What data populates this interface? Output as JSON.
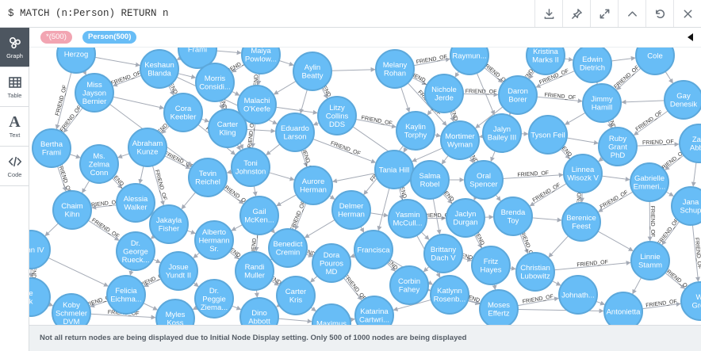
{
  "query": "$ MATCH (n:Person) RETURN n",
  "toolbar": [
    {
      "name": "download-icon"
    },
    {
      "name": "pin-icon"
    },
    {
      "name": "expand-icon"
    },
    {
      "name": "collapse-up-icon"
    },
    {
      "name": "rerun-icon"
    },
    {
      "name": "close-icon"
    }
  ],
  "sidebar": [
    {
      "name": "graph",
      "label": "Graph",
      "icon": "graph-icon"
    },
    {
      "name": "table",
      "label": "Table",
      "icon": "table-icon"
    },
    {
      "name": "text",
      "label": "Text",
      "icon": "text-icon",
      "glyph": "A"
    },
    {
      "name": "code",
      "label": "Code",
      "icon": "code-icon"
    }
  ],
  "legend": {
    "all_label": "*(500)",
    "person_label": "Person(500)"
  },
  "graph": {
    "node_color": "#68bdf6",
    "node_stroke": "#5ca8db",
    "edge_color": "#a5abb6",
    "relationship_label": "FRIEND_OF",
    "nodes": [
      {
        "id": 0,
        "lines": [
          "Herzog"
        ]
      },
      {
        "id": 1,
        "lines": [
          "Frami"
        ]
      },
      {
        "id": 2,
        "lines": [
          "Maiya",
          "Powlow..."
        ]
      },
      {
        "id": 3,
        "lines": [
          "Keshaun",
          "Blanda"
        ]
      },
      {
        "id": 4,
        "lines": [
          "Aylin",
          "Beatty"
        ]
      },
      {
        "id": 5,
        "lines": [
          "Melany",
          "Rohan"
        ]
      },
      {
        "id": 6,
        "lines": [
          "Raymun..."
        ]
      },
      {
        "id": 7,
        "lines": [
          "Kristina",
          "Marks II"
        ]
      },
      {
        "id": 8,
        "lines": [
          "Edwin",
          "Dietrich"
        ]
      },
      {
        "id": 9,
        "lines": [
          "Cole"
        ]
      },
      {
        "id": 10,
        "lines": [
          "Miss",
          "Jayson",
          "Bernier"
        ]
      },
      {
        "id": 11,
        "lines": [
          "Morris",
          "Considi..."
        ]
      },
      {
        "id": 12,
        "lines": [
          "Malachi",
          "O'Keefe"
        ]
      },
      {
        "id": 13,
        "lines": [
          "Nichole",
          "Jerde"
        ]
      },
      {
        "id": 14,
        "lines": [
          "Daron",
          "Borer"
        ]
      },
      {
        "id": 15,
        "lines": [
          "Gay",
          "Denesik"
        ]
      },
      {
        "id": 16,
        "lines": [
          "Cora",
          "Keebler"
        ]
      },
      {
        "id": 17,
        "lines": [
          "Litzy",
          "Collins",
          "DDS"
        ]
      },
      {
        "id": 18,
        "lines": [
          "Jimmy",
          "Hamill"
        ]
      },
      {
        "id": 19,
        "lines": [
          "Carter",
          "Kling"
        ]
      },
      {
        "id": 20,
        "lines": [
          "Eduardo",
          "Larson"
        ]
      },
      {
        "id": 21,
        "lines": [
          "Kaylin",
          "Torphy"
        ]
      },
      {
        "id": 22,
        "lines": [
          "Jalyn",
          "Bailey III"
        ]
      },
      {
        "id": 23,
        "lines": [
          "Tyson Feil"
        ]
      },
      {
        "id": 24,
        "lines": [
          "Mortimer",
          "Wyman"
        ]
      },
      {
        "id": 25,
        "lines": [
          "Bertha",
          "Frami"
        ]
      },
      {
        "id": 26,
        "lines": [
          "Abraham",
          "Kunze"
        ]
      },
      {
        "id": 27,
        "lines": [
          "Ruby",
          "Grant",
          "PhD"
        ]
      },
      {
        "id": 28,
        "lines": [
          "Zan",
          "Abbo"
        ]
      },
      {
        "id": 29,
        "lines": [
          "Ms.",
          "Zelma",
          "Conn"
        ]
      },
      {
        "id": 30,
        "lines": [
          "Toni",
          "Johnston"
        ]
      },
      {
        "id": 31,
        "lines": [
          "Tevin",
          "Reichel"
        ]
      },
      {
        "id": 32,
        "lines": [
          "Tania Hill"
        ]
      },
      {
        "id": 33,
        "lines": [
          "Salma",
          "Robel"
        ]
      },
      {
        "id": 34,
        "lines": [
          "Oral",
          "Spencer"
        ]
      },
      {
        "id": 35,
        "lines": [
          "Linnea",
          "Wisozk V"
        ]
      },
      {
        "id": 36,
        "lines": [
          "Gabrielle",
          "Emmeri..."
        ]
      },
      {
        "id": 37,
        "lines": [
          "Aurore",
          "Herman"
        ]
      },
      {
        "id": 38,
        "lines": [
          "Alessia",
          "Walker"
        ]
      },
      {
        "id": 39,
        "lines": [
          "Chaim",
          "Kihn"
        ]
      },
      {
        "id": 40,
        "lines": [
          "Gail",
          "McKen..."
        ]
      },
      {
        "id": 41,
        "lines": [
          "Delmer",
          "Herman"
        ]
      },
      {
        "id": 42,
        "lines": [
          "Yasmin",
          "McCull..."
        ]
      },
      {
        "id": 43,
        "lines": [
          "Jaclyn",
          "Durgan"
        ]
      },
      {
        "id": 44,
        "lines": [
          "Brenda",
          "Toy"
        ]
      },
      {
        "id": 45,
        "lines": [
          "Berenice",
          "Feest"
        ]
      },
      {
        "id": 46,
        "lines": [
          "Jana",
          "Schup"
        ]
      },
      {
        "id": 47,
        "lines": [
          "Jakayla",
          "Fisher"
        ]
      },
      {
        "id": 48,
        "lines": [
          "Alberto",
          "Hermann",
          "Sr."
        ]
      },
      {
        "id": 49,
        "lines": [
          "Benedict",
          "Cremin"
        ]
      },
      {
        "id": 50,
        "lines": [
          "Francisca"
        ]
      },
      {
        "id": 51,
        "lines": [
          "Brittany",
          "Dach V"
        ]
      },
      {
        "id": 52,
        "lines": [
          "Fritz",
          "Hayes"
        ]
      },
      {
        "id": 53,
        "lines": [
          "Christian",
          "Lubowitz"
        ]
      },
      {
        "id": 54,
        "lines": [
          "Linnie",
          "Stamm"
        ]
      },
      {
        "id": 55,
        "lines": [
          "Dr.",
          "George",
          "Rueck..."
        ]
      },
      {
        "id": 56,
        "lines": [
          "Josue",
          "Yundt II"
        ]
      },
      {
        "id": 57,
        "lines": [
          "Randi",
          "Muller"
        ]
      },
      {
        "id": 58,
        "lines": [
          "Dora",
          "Pouros",
          "MD"
        ]
      },
      {
        "id": 59,
        "lines": [
          "Corbin",
          "Fahey"
        ]
      },
      {
        "id": 60,
        "lines": [
          "Kynn IV"
        ]
      },
      {
        "id": 61,
        "lines": [
          "Felicia",
          "Eichma..."
        ]
      },
      {
        "id": 62,
        "lines": [
          "Dr.",
          "Peggie",
          "Ziema..."
        ]
      },
      {
        "id": 63,
        "lines": [
          "Carter",
          "Kris"
        ]
      },
      {
        "id": 64,
        "lines": [
          "Katlynn",
          "Rosenb..."
        ]
      },
      {
        "id": 65,
        "lines": [
          "Moses",
          "Effertz"
        ]
      },
      {
        "id": 66,
        "lines": [
          "Johnath..."
        ]
      },
      {
        "id": 67,
        "lines": [
          "Antonietta"
        ]
      },
      {
        "id": 68,
        "lines": [
          "Wi",
          "Gree"
        ]
      },
      {
        "id": 69,
        "lines": [
          "e",
          "k"
        ]
      },
      {
        "id": 70,
        "lines": [
          "Koby",
          "Schmeler",
          "DVM"
        ]
      },
      {
        "id": 71,
        "lines": [
          "Myles",
          "Koss"
        ]
      },
      {
        "id": 72,
        "lines": [
          "Dino",
          "Abbott"
        ]
      },
      {
        "id": 73,
        "lines": [
          "Maximus"
        ]
      },
      {
        "id": 74,
        "lines": [
          "Katarina",
          "Cartwri..."
        ]
      }
    ],
    "edges": [
      [
        0,
        10
      ],
      [
        0,
        3
      ],
      [
        0,
        25
      ],
      [
        1,
        3
      ],
      [
        1,
        11
      ],
      [
        1,
        2
      ],
      [
        2,
        12
      ],
      [
        2,
        4
      ],
      [
        3,
        10
      ],
      [
        3,
        11
      ],
      [
        3,
        16
      ],
      [
        4,
        12
      ],
      [
        4,
        17
      ],
      [
        4,
        5
      ],
      [
        5,
        13
      ],
      [
        5,
        21
      ],
      [
        5,
        6
      ],
      [
        6,
        13
      ],
      [
        6,
        14
      ],
      [
        7,
        8
      ],
      [
        7,
        14
      ],
      [
        8,
        9
      ],
      [
        8,
        18
      ],
      [
        9,
        15
      ],
      [
        9,
        18
      ],
      [
        10,
        16
      ],
      [
        10,
        25
      ],
      [
        11,
        12
      ],
      [
        11,
        19
      ],
      [
        12,
        17
      ],
      [
        12,
        19
      ],
      [
        13,
        21
      ],
      [
        13,
        14
      ],
      [
        14,
        22
      ],
      [
        14,
        18
      ],
      [
        15,
        18
      ],
      [
        15,
        27
      ],
      [
        16,
        19
      ],
      [
        16,
        26
      ],
      [
        17,
        20
      ],
      [
        17,
        21
      ],
      [
        18,
        23
      ],
      [
        18,
        27
      ],
      [
        19,
        20
      ],
      [
        19,
        30
      ],
      [
        20,
        30
      ],
      [
        20,
        32
      ],
      [
        21,
        24
      ],
      [
        21,
        32
      ],
      [
        22,
        23
      ],
      [
        22,
        24
      ],
      [
        23,
        27
      ],
      [
        23,
        35
      ],
      [
        24,
        33
      ],
      [
        24,
        34
      ],
      [
        25,
        29
      ],
      [
        25,
        39
      ],
      [
        26,
        29
      ],
      [
        26,
        31
      ],
      [
        26,
        38
      ],
      [
        27,
        28
      ],
      [
        27,
        35
      ],
      [
        28,
        36
      ],
      [
        28,
        46
      ],
      [
        29,
        38
      ],
      [
        29,
        39
      ],
      [
        30,
        31
      ],
      [
        30,
        37
      ],
      [
        31,
        40
      ],
      [
        31,
        47
      ],
      [
        32,
        33
      ],
      [
        32,
        37
      ],
      [
        32,
        42
      ],
      [
        33,
        34
      ],
      [
        33,
        43
      ],
      [
        34,
        44
      ],
      [
        34,
        35
      ],
      [
        35,
        36
      ],
      [
        35,
        45
      ],
      [
        36,
        46
      ],
      [
        36,
        54
      ],
      [
        37,
        40
      ],
      [
        37,
        41
      ],
      [
        38,
        47
      ],
      [
        38,
        39
      ],
      [
        39,
        60
      ],
      [
        39,
        55
      ],
      [
        40,
        48
      ],
      [
        40,
        49
      ],
      [
        41,
        42
      ],
      [
        41,
        50
      ],
      [
        42,
        51
      ],
      [
        42,
        43
      ],
      [
        43,
        44
      ],
      [
        43,
        52
      ],
      [
        44,
        45
      ],
      [
        44,
        53
      ],
      [
        45,
        54
      ],
      [
        46,
        54
      ],
      [
        47,
        48
      ],
      [
        47,
        55
      ],
      [
        48,
        56
      ],
      [
        48,
        57
      ],
      [
        49,
        57
      ],
      [
        49,
        58
      ],
      [
        50,
        58
      ],
      [
        50,
        59
      ],
      [
        51,
        59
      ],
      [
        51,
        52
      ],
      [
        52,
        53
      ],
      [
        52,
        65
      ],
      [
        53,
        66
      ],
      [
        53,
        54
      ],
      [
        54,
        67
      ],
      [
        54,
        68
      ],
      [
        55,
        56
      ],
      [
        55,
        61
      ],
      [
        56,
        62
      ],
      [
        57,
        63
      ],
      [
        58,
        63
      ],
      [
        58,
        74
      ],
      [
        59,
        64
      ],
      [
        60,
        69
      ],
      [
        60,
        61
      ],
      [
        61,
        70
      ],
      [
        61,
        71
      ],
      [
        62,
        71
      ],
      [
        62,
        72
      ],
      [
        63,
        72
      ],
      [
        63,
        73
      ],
      [
        64,
        65
      ],
      [
        64,
        74
      ],
      [
        65,
        66
      ],
      [
        66,
        67
      ],
      [
        67,
        68
      ],
      [
        69,
        70
      ],
      [
        70,
        71
      ],
      [
        72,
        73
      ],
      [
        73,
        74
      ],
      [
        3,
        20
      ],
      [
        5,
        24
      ],
      [
        10,
        31
      ],
      [
        12,
        30
      ],
      [
        17,
        33
      ],
      [
        21,
        41
      ],
      [
        22,
        34
      ],
      [
        26,
        47
      ],
      [
        32,
        50
      ],
      [
        40,
        57
      ],
      [
        42,
        64
      ],
      [
        13,
        24
      ],
      [
        4,
        20
      ],
      [
        16,
        30
      ],
      [
        30,
        40
      ],
      [
        37,
        49
      ],
      [
        33,
        51
      ],
      [
        34,
        43
      ],
      [
        45,
        53
      ],
      [
        35,
        44
      ],
      [
        6,
        22
      ],
      [
        8,
        14
      ],
      [
        50,
        64
      ],
      [
        56,
        61
      ],
      [
        57,
        72
      ],
      [
        59,
        65
      ],
      [
        65,
        67
      ],
      [
        2,
        11
      ],
      [
        41,
        49
      ],
      [
        20,
        37
      ],
      [
        24,
        32
      ],
      [
        36,
        45
      ],
      [
        11,
        30
      ],
      [
        46,
        68
      ],
      [
        14,
        24
      ]
    ]
  },
  "status": {
    "message": "Not all return nodes are being displayed due to Initial Node Display setting. Only 500 of 1000 nodes are being displayed"
  }
}
